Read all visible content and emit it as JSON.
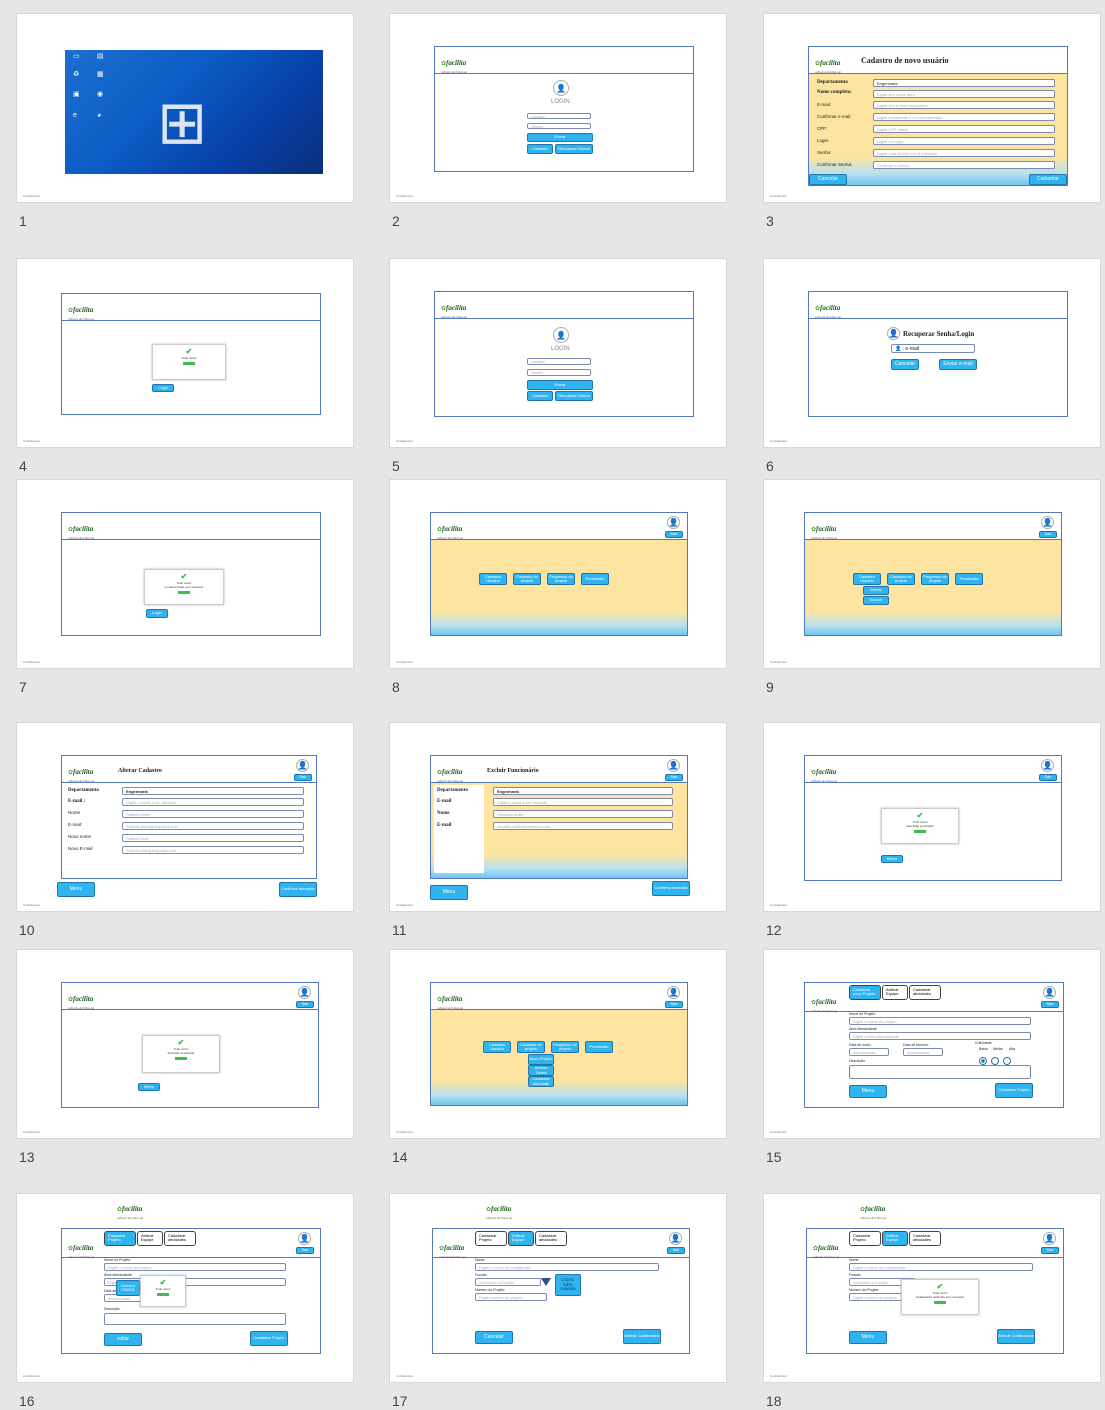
{
  "slides": [
    {
      "number": "1"
    },
    {
      "number": "2"
    },
    {
      "number": "3"
    },
    {
      "number": "4"
    },
    {
      "number": "5"
    },
    {
      "number": "6"
    },
    {
      "number": "7"
    },
    {
      "number": "8"
    },
    {
      "number": "9"
    },
    {
      "number": "10"
    },
    {
      "number": "11"
    },
    {
      "number": "12"
    },
    {
      "number": "13"
    },
    {
      "number": "14"
    },
    {
      "number": "15"
    },
    {
      "number": "16"
    },
    {
      "number": "17"
    },
    {
      "number": "18"
    }
  ],
  "common": {
    "confidential": "Confidencial",
    "logo_name": "facilita",
    "logo_tagline": "software de follow-up",
    "sair": "Sair",
    "menu": "Menu",
    "ok_title": "Tudo certo!",
    "colors": {
      "accent": "#2fb4f0",
      "frame": "#5577bb",
      "yellow": "#fde4a0",
      "success": "#3cbc4a"
    }
  },
  "login": {
    "title": "LOGIN",
    "user_ph": "Usuário",
    "pass_ph": "Senha",
    "enter": "Entrar",
    "register": "Cadastro",
    "recover": "Recuperar Senha"
  },
  "register": {
    "title": "Cadastro de novo usuário",
    "labels": [
      "Departamento",
      "Nome completo:",
      "E-mail:",
      "Confirmar e-mail:",
      "CPF:",
      "Login:",
      "Senha:",
      "Confirmar Senha:"
    ],
    "dept_value": "Engenharia",
    "placeholders": [
      "Digite seu nome aqui",
      "Digite seu e-mail corporativo",
      "Digite novamente o e-mail informado",
      "Digite CPF válido",
      "Digite um login",
      "Digite uma senha com 8 posições",
      "Confirme a senha"
    ],
    "cancel": "Cancelar",
    "submit": "Cadastrar"
  },
  "slide4": {
    "login_btn": "Login"
  },
  "recover": {
    "title": "Recuperar Senha/Login",
    "email": "e-mail",
    "cancel": "Cancelar",
    "send": "Enviar e-mail"
  },
  "slide7": {
    "msg": "e-mail enviado com sucesso!",
    "login_btn": "Login"
  },
  "menu_main": [
    "Cadastro Usuário",
    "Cadastro de projeto",
    "Progresso do projeto",
    "Permissão"
  ],
  "menu9_sub": [
    "Alterar",
    "Excluir"
  ],
  "alter": {
    "title": "Alterar Cadastro",
    "labels": [
      "Departamento",
      "E-mail :",
      "Nome",
      "E-mail:",
      "Novo nome",
      "Novo E-mail"
    ],
    "dept_value": "Engenharia",
    "values": [
      "Digite o email a ser alterado",
      "Patricia Alves",
      "Patricia.alves@empresa.com",
      "Patricia Dias",
      "Patricia.dias@empresa.com"
    ],
    "confirm": "Confirma alteração"
  },
  "delete": {
    "title": "Excluir Funcionário",
    "labels": [
      "Departamento",
      "E-mail",
      "Nome",
      "E-mail"
    ],
    "dept_value": "Engenharia",
    "values": [
      "Digite o email a ser excluído",
      "Reinaldo Abilio",
      "reinaldo.abilio@empresa.com"
    ],
    "confirm": "Confirma exclusão"
  },
  "slide12": {
    "msg": "Alteração concluída!"
  },
  "slide13": {
    "msg": "Exclusão concluída!"
  },
  "menu14_sub": [
    "Novo Projeto",
    "Atribuir Tarefa",
    "Cadastrar Atividade"
  ],
  "tabs": [
    "Cadastrar novo Projeto",
    "Atribuir Equipe",
    "Cadastrar atividades"
  ],
  "tabs16": [
    "Cadastrar Projeto",
    "Atribuir Equipe",
    "Cadastrar atividades"
  ],
  "project": {
    "name_lbl": "Nome do Projeto",
    "name_ph": "Digite o nome do projeto",
    "area_lbl": "Área demandante",
    "area_ph": "Digite a área demandante",
    "start_lbl": "Data de início:",
    "end_lbl": "Data de término:",
    "date_ph": "dd/mm/aaaa",
    "crit_lbl": "Criticidade",
    "crit_opts": [
      "Baixa",
      "Média",
      "Alta"
    ],
    "desc_lbl": "Descrição:",
    "submit": "Cadastrar Projeto",
    "back": "voltar",
    "number_popup": "Numero P00001"
  },
  "team": {
    "name_lbl": "Nome:",
    "name_ph": "Digite o nome do colaborador",
    "func_lbl": "Função",
    "func_ph": "Selecione a Função",
    "proj_lbl": "Numero do Projeto:",
    "proj_ph": "Digite numero do projeto",
    "roles": "Coord. Adm. Usuário",
    "cancel": "Cancelar",
    "submit": "Atribuir Colaborador",
    "success": "Colaborador atribuído com sucesso!"
  }
}
